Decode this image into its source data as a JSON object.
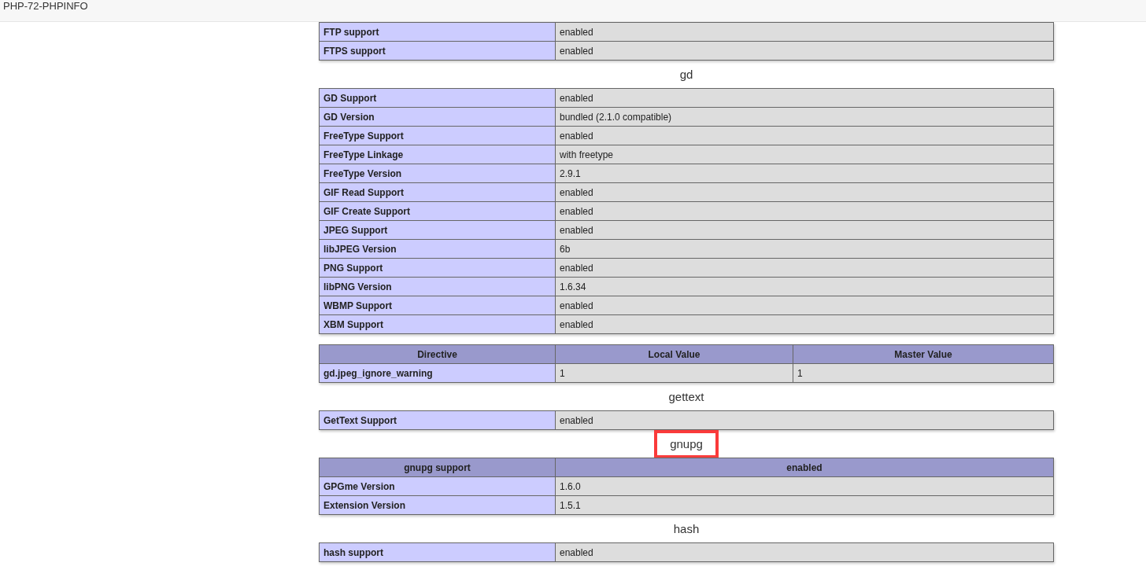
{
  "title": "PHP-72-PHPINFO",
  "sections": [
    {
      "tables": [
        {
          "rows": [
            {
              "cells": [
                "FTP support",
                "enabled"
              ]
            },
            {
              "cells": [
                "FTPS support",
                "enabled"
              ]
            }
          ]
        }
      ]
    },
    {
      "heading": "gd",
      "tables": [
        {
          "rows": [
            {
              "cells": [
                "GD Support",
                "enabled"
              ]
            },
            {
              "cells": [
                "GD Version",
                "bundled (2.1.0 compatible)"
              ]
            },
            {
              "cells": [
                "FreeType Support",
                "enabled"
              ]
            },
            {
              "cells": [
                "FreeType Linkage",
                "with freetype"
              ]
            },
            {
              "cells": [
                "FreeType Version",
                "2.9.1"
              ]
            },
            {
              "cells": [
                "GIF Read Support",
                "enabled"
              ]
            },
            {
              "cells": [
                "GIF Create Support",
                "enabled"
              ]
            },
            {
              "cells": [
                "JPEG Support",
                "enabled"
              ]
            },
            {
              "cells": [
                "libJPEG Version",
                "6b"
              ]
            },
            {
              "cells": [
                "PNG Support",
                "enabled"
              ]
            },
            {
              "cells": [
                "libPNG Version",
                "1.6.34"
              ]
            },
            {
              "cells": [
                "WBMP Support",
                "enabled"
              ]
            },
            {
              "cells": [
                "XBM Support",
                "enabled"
              ]
            }
          ]
        },
        {
          "header": [
            "Directive",
            "Local Value",
            "Master Value"
          ],
          "rows": [
            {
              "cells": [
                "gd.jpeg_ignore_warning",
                "1",
                "1"
              ]
            }
          ]
        }
      ]
    },
    {
      "heading": "gettext",
      "tables": [
        {
          "rows": [
            {
              "cells": [
                "GetText Support",
                "enabled"
              ]
            }
          ]
        }
      ]
    },
    {
      "heading": "gnupg",
      "highlighted": true,
      "tables": [
        {
          "header": [
            "gnupg support",
            "enabled"
          ],
          "rows": [
            {
              "cells": [
                "GPGme Version",
                "1.6.0"
              ]
            },
            {
              "cells": [
                "Extension Version",
                "1.5.1"
              ]
            }
          ]
        }
      ]
    },
    {
      "heading": "hash",
      "tables": [
        {
          "rows": [
            {
              "cells": [
                "hash support",
                "enabled"
              ]
            }
          ]
        }
      ]
    }
  ]
}
